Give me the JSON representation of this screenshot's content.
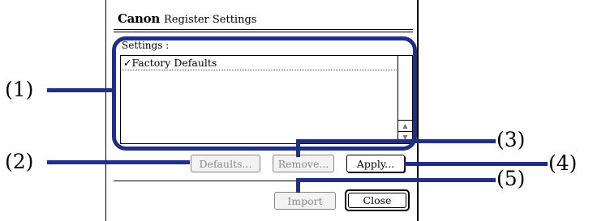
{
  "dialog": {
    "brand": "Canon",
    "title": "Register Settings",
    "settings_label": "Settings :",
    "list_items": [
      {
        "label": "Factory Defaults",
        "checked": true
      }
    ],
    "buttons": {
      "defaults": "Defaults...",
      "remove": "Remove...",
      "apply": "Apply...",
      "import": "Import",
      "close": "Close"
    },
    "scroll_up_icon": "triangle-up",
    "scroll_down_icon": "triangle-down"
  },
  "callouts": {
    "c1": "(1)",
    "c2": "(2)",
    "c3": "(3)",
    "c4": "(4)",
    "c5": "(5)"
  },
  "colors": {
    "callout": "#1f2f88",
    "disabled_text": "#8a8a8a"
  }
}
